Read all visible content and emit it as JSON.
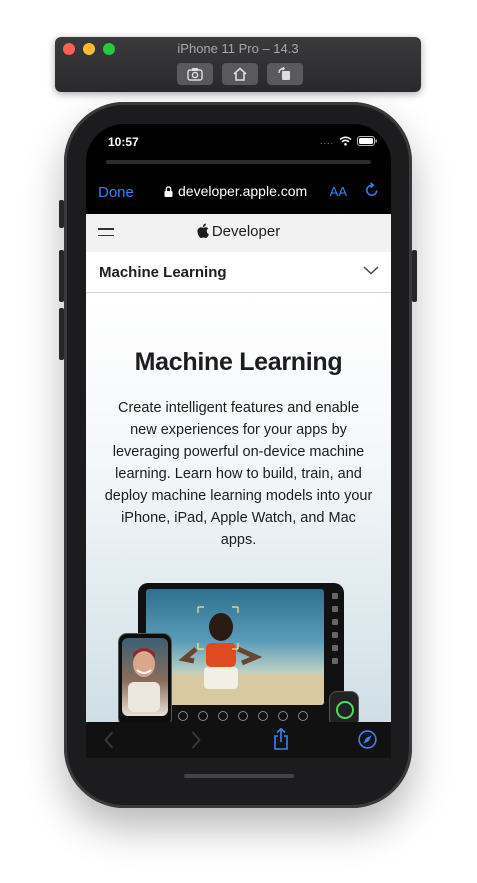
{
  "simulator": {
    "title": "iPhone 11 Pro – 14.3",
    "buttons": [
      "screenshot-icon",
      "home-icon",
      "rotate-icon"
    ]
  },
  "status_bar": {
    "time": "10:57",
    "signal_dots": "....",
    "icons": [
      "wifi-icon",
      "battery-icon"
    ]
  },
  "safari": {
    "done_label": "Done",
    "url": "developer.apple.com",
    "aa_label": "AA",
    "icons": [
      "lock-icon",
      "reload-icon"
    ],
    "bottom_icons": [
      "back-icon",
      "forward-icon",
      "share-icon",
      "compass-icon"
    ]
  },
  "site": {
    "brand": "Developer",
    "local_nav_title": "Machine Learning",
    "hero_title": "Machine Learning",
    "hero_text": "Create intelligent features and enable new experiences for your apps by leveraging powerful on-device machine learning. Learn how to build, train, and deploy machine learning models into your iPhone, iPad, Apple Watch, and Mac apps."
  },
  "colors": {
    "accent": "#3a82f7",
    "chrome_dark": "#1c1c1e",
    "traffic_red": "#ff5f57",
    "traffic_yellow": "#febc2e",
    "traffic_green": "#28c840"
  }
}
